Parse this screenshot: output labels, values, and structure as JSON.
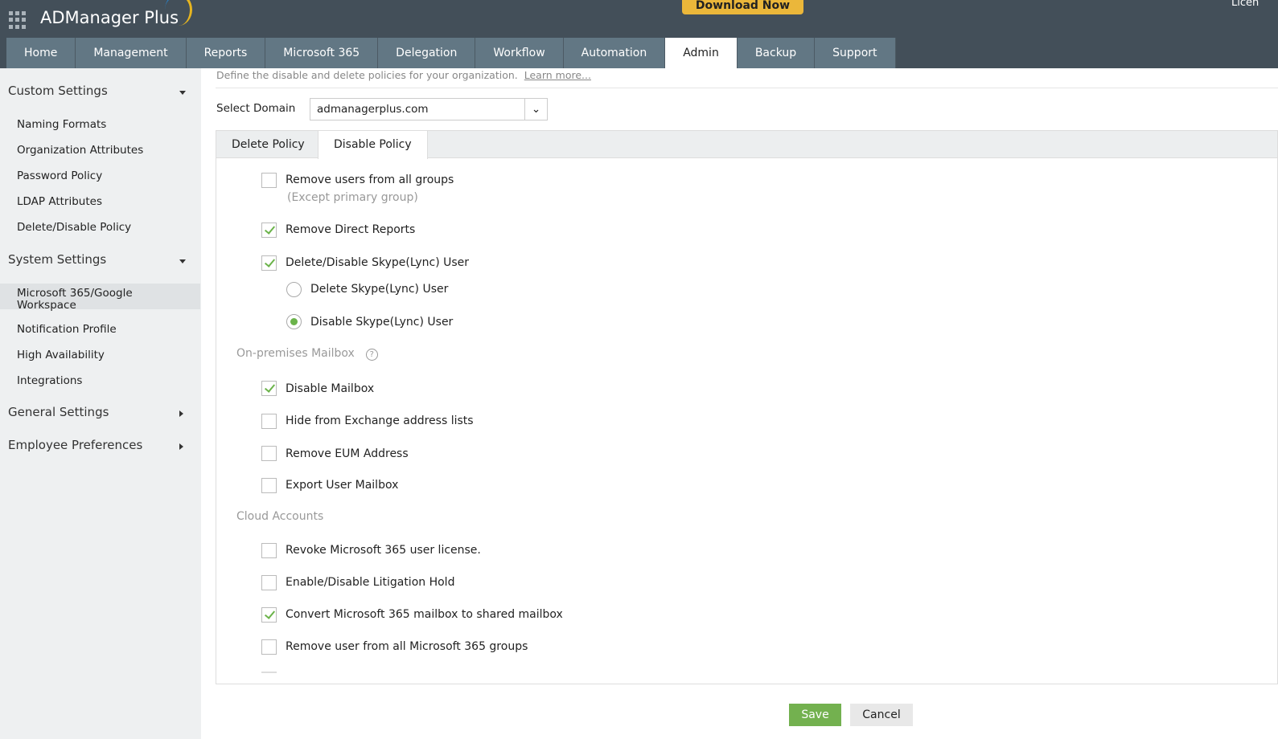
{
  "header": {
    "app_name": "ADManager Plus",
    "download": "Download Now",
    "license": "Licen"
  },
  "nav": [
    "Home",
    "Management",
    "Reports",
    "Microsoft 365",
    "Delegation",
    "Workflow",
    "Automation",
    "Admin",
    "Backup",
    "Support"
  ],
  "sidebar": {
    "custom": "Custom Settings",
    "custom_items": [
      "Naming Formats",
      "Organization Attributes",
      "Password Policy",
      "LDAP Attributes",
      "Delete/Disable Policy"
    ],
    "system": "System Settings",
    "system_items": [
      "Microsoft 365/Google Workspace",
      "Notification Profile",
      "High Availability",
      "Integrations"
    ],
    "general": "General Settings",
    "employee": "Employee Preferences"
  },
  "main": {
    "description": "Define the disable and delete policies for your organization.",
    "learn_more": "Learn more...",
    "domain_label": "Select Domain",
    "domain_value": "admanagerplus.com",
    "tabs": [
      "Delete Policy",
      "Disable Policy"
    ],
    "opt_remove_groups": "Remove users from all groups",
    "opt_remove_groups_note": "(Except primary group)",
    "opt_direct_reports": "Remove Direct Reports",
    "opt_skype": "Delete/Disable Skype(Lync) User",
    "radio_delete_skype": "Delete Skype(Lync) User",
    "radio_disable_skype": "Disable Skype(Lync) User",
    "sec_mailbox": "On-premises Mailbox",
    "opt_disable_mailbox": "Disable Mailbox",
    "opt_hide_exchange": "Hide from Exchange address lists",
    "opt_remove_eum": "Remove EUM Address",
    "opt_export_mailbox": "Export User Mailbox",
    "sec_cloud": "Cloud Accounts",
    "opt_revoke_license": "Revoke Microsoft 365 user license.",
    "opt_litigation": "Enable/Disable Litigation Hold",
    "opt_convert_shared": "Convert Microsoft 365 mailbox to shared mailbox",
    "opt_remove_m365_groups": "Remove user from all Microsoft 365 groups",
    "save": "Save",
    "cancel": "Cancel"
  }
}
